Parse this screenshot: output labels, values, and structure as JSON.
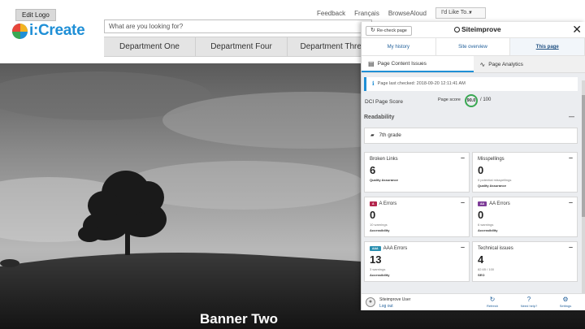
{
  "header": {
    "edit_logo": "Edit Logo",
    "logo_text": "i:Create",
    "links": [
      "Feedback",
      "Français",
      "BrowseAloud"
    ],
    "like_select": "I'd Like To...",
    "search_placeholder": "What are you looking for?",
    "departments": [
      "Department One",
      "Department Four",
      "Department Three"
    ]
  },
  "banner": {
    "title": "Banner Two"
  },
  "siteimprove": {
    "recheck_label": "Re-check page",
    "brand": "Siteimprove",
    "close_glyph": "✕",
    "nav": [
      "My history",
      "Site overview",
      "This page"
    ],
    "active_nav": "This page",
    "tabs": [
      "Page Content Issues",
      "Page Analytics"
    ],
    "active_tab": "Page Content Issues",
    "last_checked": "Page last checked: 2018-09-20 12:11:41 AM",
    "score_label": "DCI Page Score",
    "score_sub": "Page score",
    "score_value": "90.0",
    "score_max": "/ 100",
    "section_title": "Readability",
    "readability_grade": "7th grade",
    "cards": [
      {
        "title": "Broken Links",
        "value": "6",
        "sub": "",
        "category": "Quality Assurance"
      },
      {
        "title": "Misspellings",
        "value": "0",
        "sub": "0 potential misspellings",
        "category": "Quality Assurance"
      },
      {
        "badge": "A",
        "title": "A Errors",
        "value": "0",
        "sub": "10 warnings",
        "category": "Accessibility"
      },
      {
        "badge": "AA",
        "title": "AA Errors",
        "value": "0",
        "sub": "6 warnings",
        "category": "Accessibility"
      },
      {
        "badge": "AAA",
        "title": "AAA Errors",
        "value": "13",
        "sub": "3 warnings",
        "category": "Accessibility"
      },
      {
        "title": "Technical issues",
        "value": "4",
        "sub": "82.65 / 100",
        "category": "SEO"
      }
    ],
    "footer": {
      "user": "Siteimprove User",
      "logout": "Log out",
      "buttons": [
        "Refresh",
        "Need help?",
        "Settings"
      ]
    },
    "colors": {
      "accent": "#1f8fd6",
      "score_ring": "#3aa853",
      "badge_a": "#b3264d",
      "badge_aa": "#7d3c98",
      "badge_aaa": "#2a8fb0"
    }
  }
}
